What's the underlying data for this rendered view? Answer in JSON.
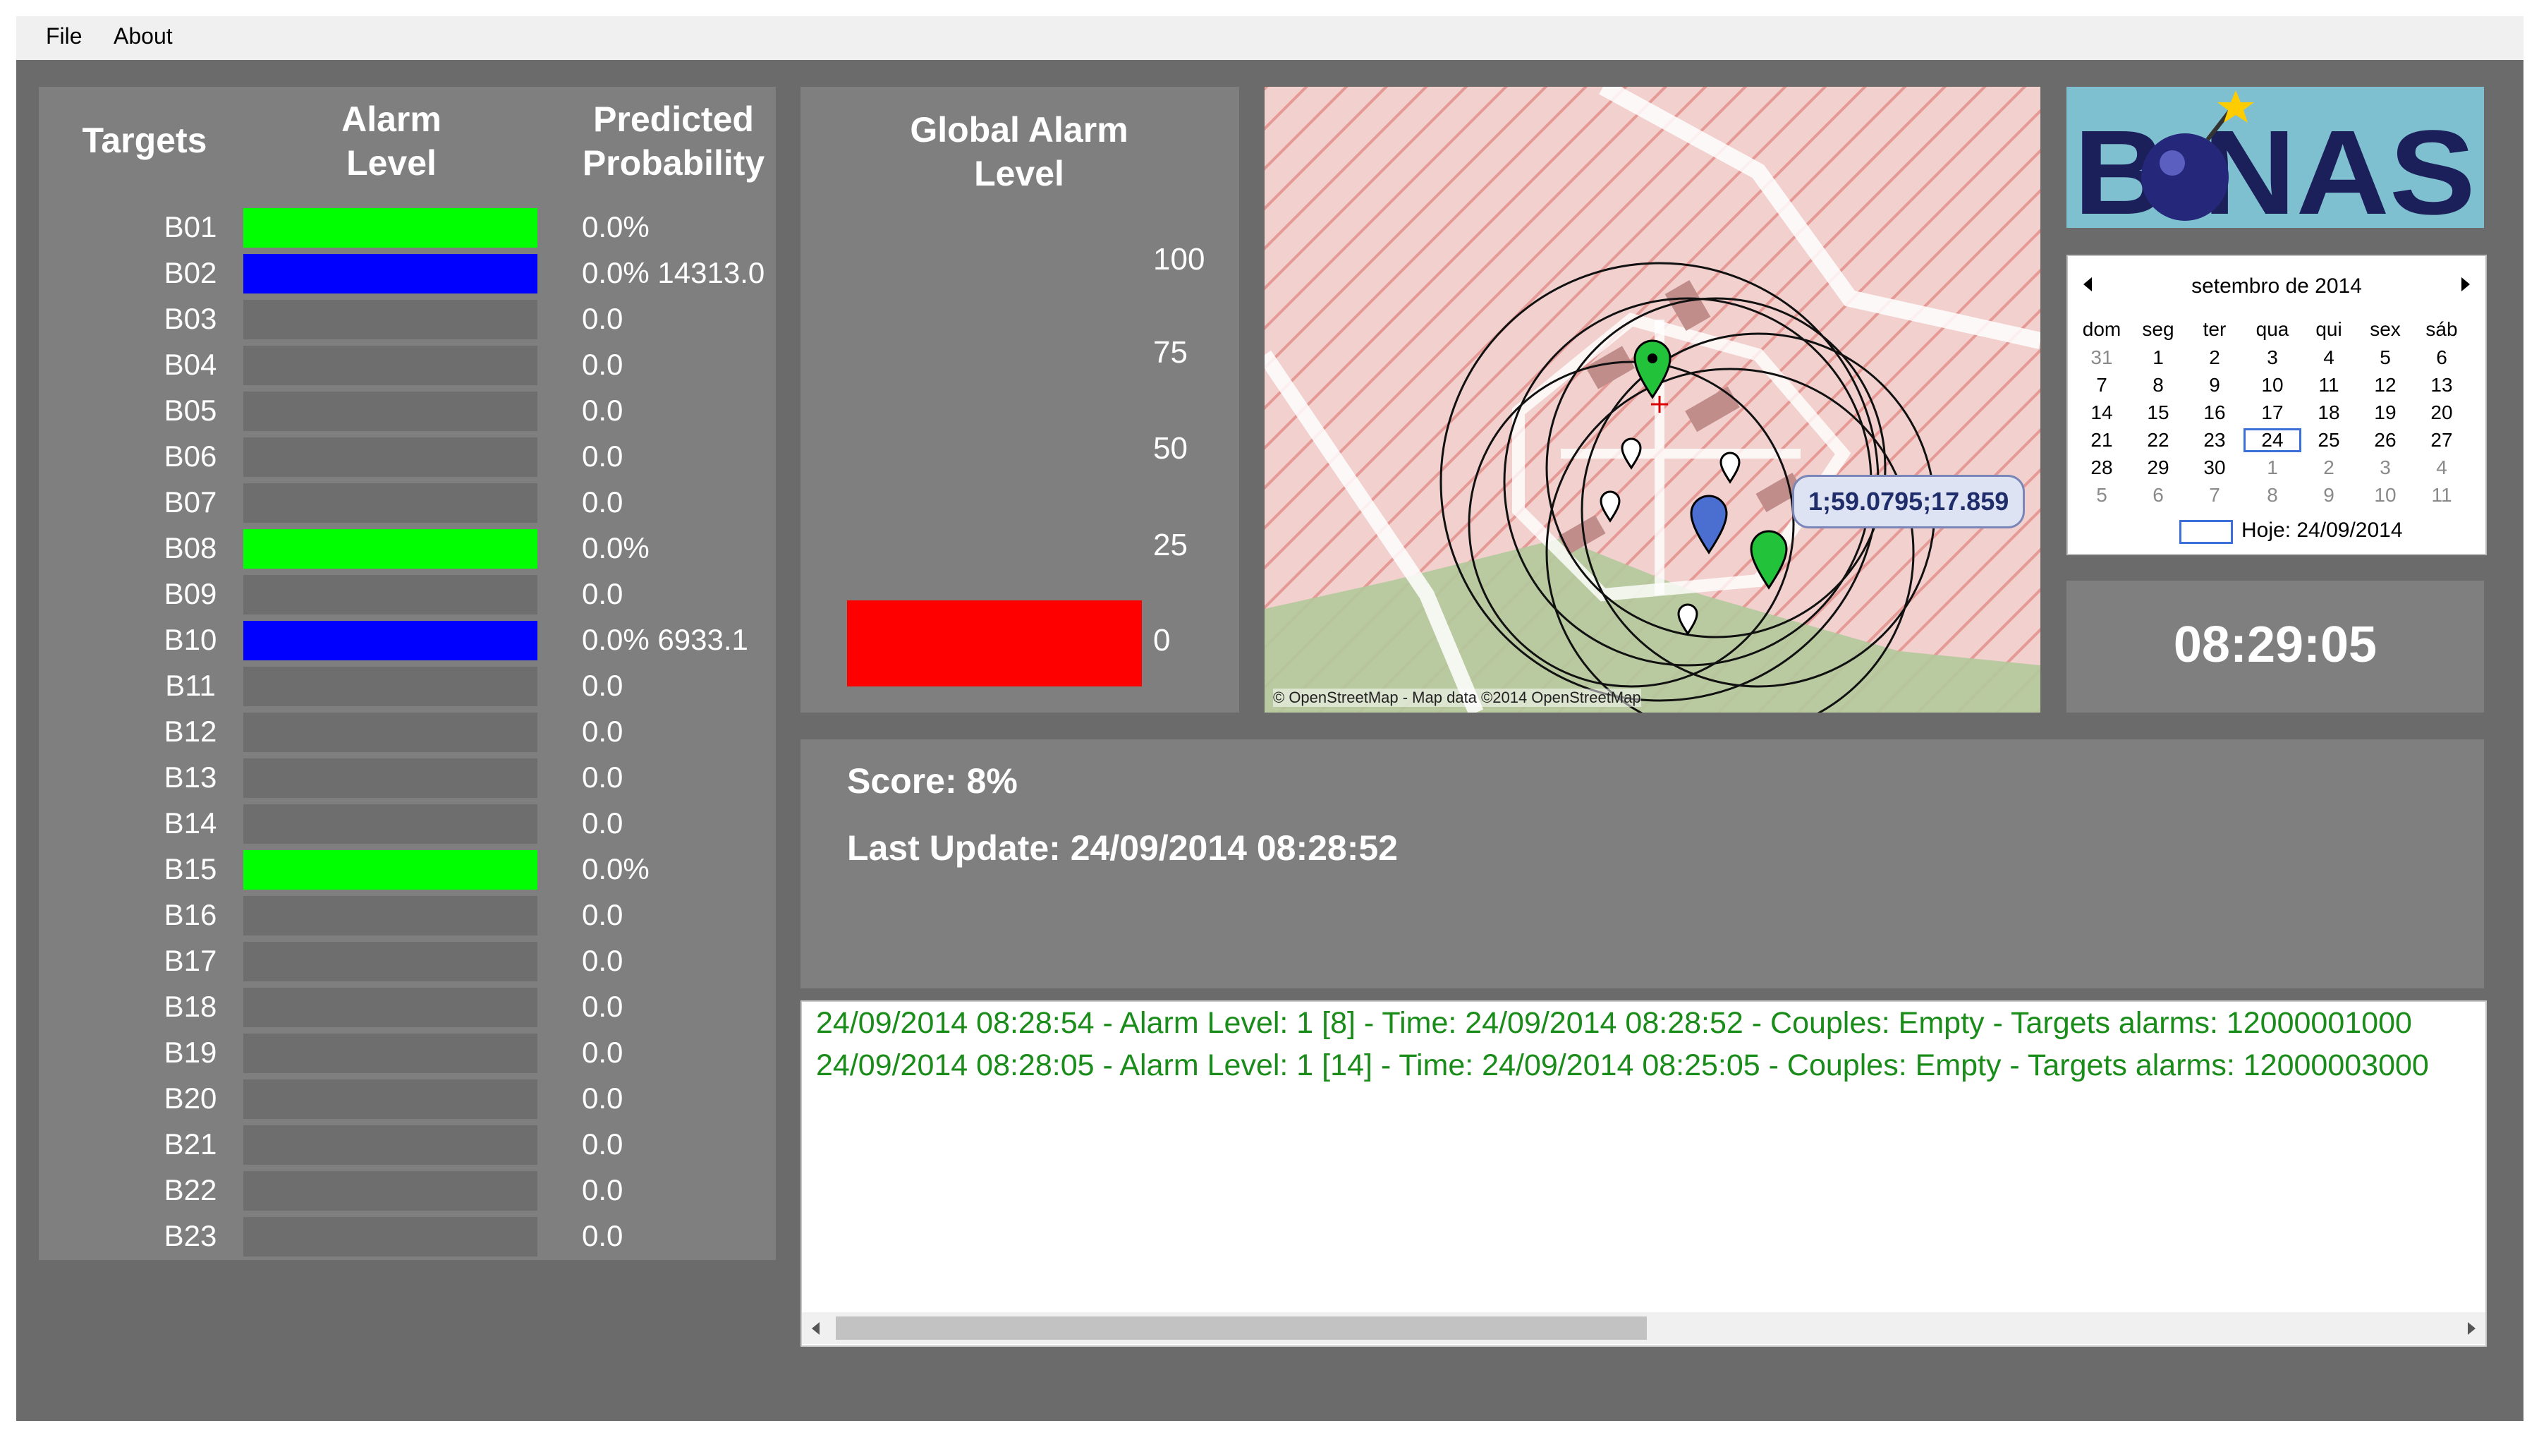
{
  "menu": {
    "file": "File",
    "about": "About"
  },
  "targets_panel": {
    "col_targets": "Targets",
    "col_alarm": "Alarm Level",
    "col_prob": "Predicted Probability",
    "rows": [
      {
        "label": "B01",
        "alarm": "green",
        "prob": "0.0%"
      },
      {
        "label": "B02",
        "alarm": "blue",
        "prob": "0.0% 14313.0"
      },
      {
        "label": "B03",
        "alarm": "none",
        "prob": "0.0"
      },
      {
        "label": "B04",
        "alarm": "none",
        "prob": "0.0"
      },
      {
        "label": "B05",
        "alarm": "none",
        "prob": "0.0"
      },
      {
        "label": "B06",
        "alarm": "none",
        "prob": "0.0"
      },
      {
        "label": "B07",
        "alarm": "none",
        "prob": "0.0"
      },
      {
        "label": "B08",
        "alarm": "green",
        "prob": "0.0%"
      },
      {
        "label": "B09",
        "alarm": "none",
        "prob": "0.0"
      },
      {
        "label": "B10",
        "alarm": "blue",
        "prob": "0.0% 6933.1"
      },
      {
        "label": "B11",
        "alarm": "none",
        "prob": "0.0"
      },
      {
        "label": "B12",
        "alarm": "none",
        "prob": "0.0"
      },
      {
        "label": "B13",
        "alarm": "none",
        "prob": "0.0"
      },
      {
        "label": "B14",
        "alarm": "none",
        "prob": "0.0"
      },
      {
        "label": "B15",
        "alarm": "green",
        "prob": "0.0%"
      },
      {
        "label": "B16",
        "alarm": "none",
        "prob": "0.0"
      },
      {
        "label": "B17",
        "alarm": "none",
        "prob": "0.0"
      },
      {
        "label": "B18",
        "alarm": "none",
        "prob": "0.0"
      },
      {
        "label": "B19",
        "alarm": "none",
        "prob": "0.0"
      },
      {
        "label": "B20",
        "alarm": "none",
        "prob": "0.0"
      },
      {
        "label": "B21",
        "alarm": "none",
        "prob": "0.0"
      },
      {
        "label": "B22",
        "alarm": "none",
        "prob": "0.0"
      },
      {
        "label": "B23",
        "alarm": "none",
        "prob": "0.0"
      }
    ]
  },
  "global_alarm": {
    "title": "Global Alarm Level",
    "ticks": [
      "100",
      "75",
      "50",
      "25",
      "0"
    ],
    "level": 0,
    "bar_color": "#ff0000"
  },
  "map": {
    "coord_label": "1;59.0795;17.859",
    "attribution": "© OpenStreetMap - Map data ©2014 OpenStreetMap"
  },
  "logo": {
    "text": "BONAS"
  },
  "calendar": {
    "month_title": "setembro de 2014",
    "weekdays": [
      "dom",
      "seg",
      "ter",
      "qua",
      "qui",
      "sex",
      "sáb"
    ],
    "weeks": [
      [
        "31",
        "1",
        "2",
        "3",
        "4",
        "5",
        "6"
      ],
      [
        "7",
        "8",
        "9",
        "10",
        "11",
        "12",
        "13"
      ],
      [
        "14",
        "15",
        "16",
        "17",
        "18",
        "19",
        "20"
      ],
      [
        "21",
        "22",
        "23",
        "24",
        "25",
        "26",
        "27"
      ],
      [
        "28",
        "29",
        "30",
        "1",
        "2",
        "3",
        "4"
      ],
      [
        "5",
        "6",
        "7",
        "8",
        "9",
        "10",
        "11"
      ]
    ],
    "selected_day": "24",
    "today_label": "Hoje: 24/09/2014"
  },
  "clock": {
    "time": "08:29:05"
  },
  "status": {
    "score": "Score: 8%",
    "last_update": "Last Update: 24/09/2014 08:28:52"
  },
  "log": {
    "lines": [
      "24/09/2014 08:28:54 - Alarm Level: 1 [8] - Time: 24/09/2014 08:28:52 - Couples: Empty - Targets alarms: 12000001000",
      "24/09/2014 08:28:05 - Alarm Level: 1 [14] - Time: 24/09/2014 08:25:05 - Couples: Empty - Targets alarms: 12000003000"
    ]
  },
  "colors": {
    "green": "#00ff00",
    "blue": "#0000ff",
    "none": "#6e6e6e",
    "log_text": "#1a8c1a",
    "app_bg": "#6b6b6b",
    "panel_bg": "#7f7f7f"
  }
}
